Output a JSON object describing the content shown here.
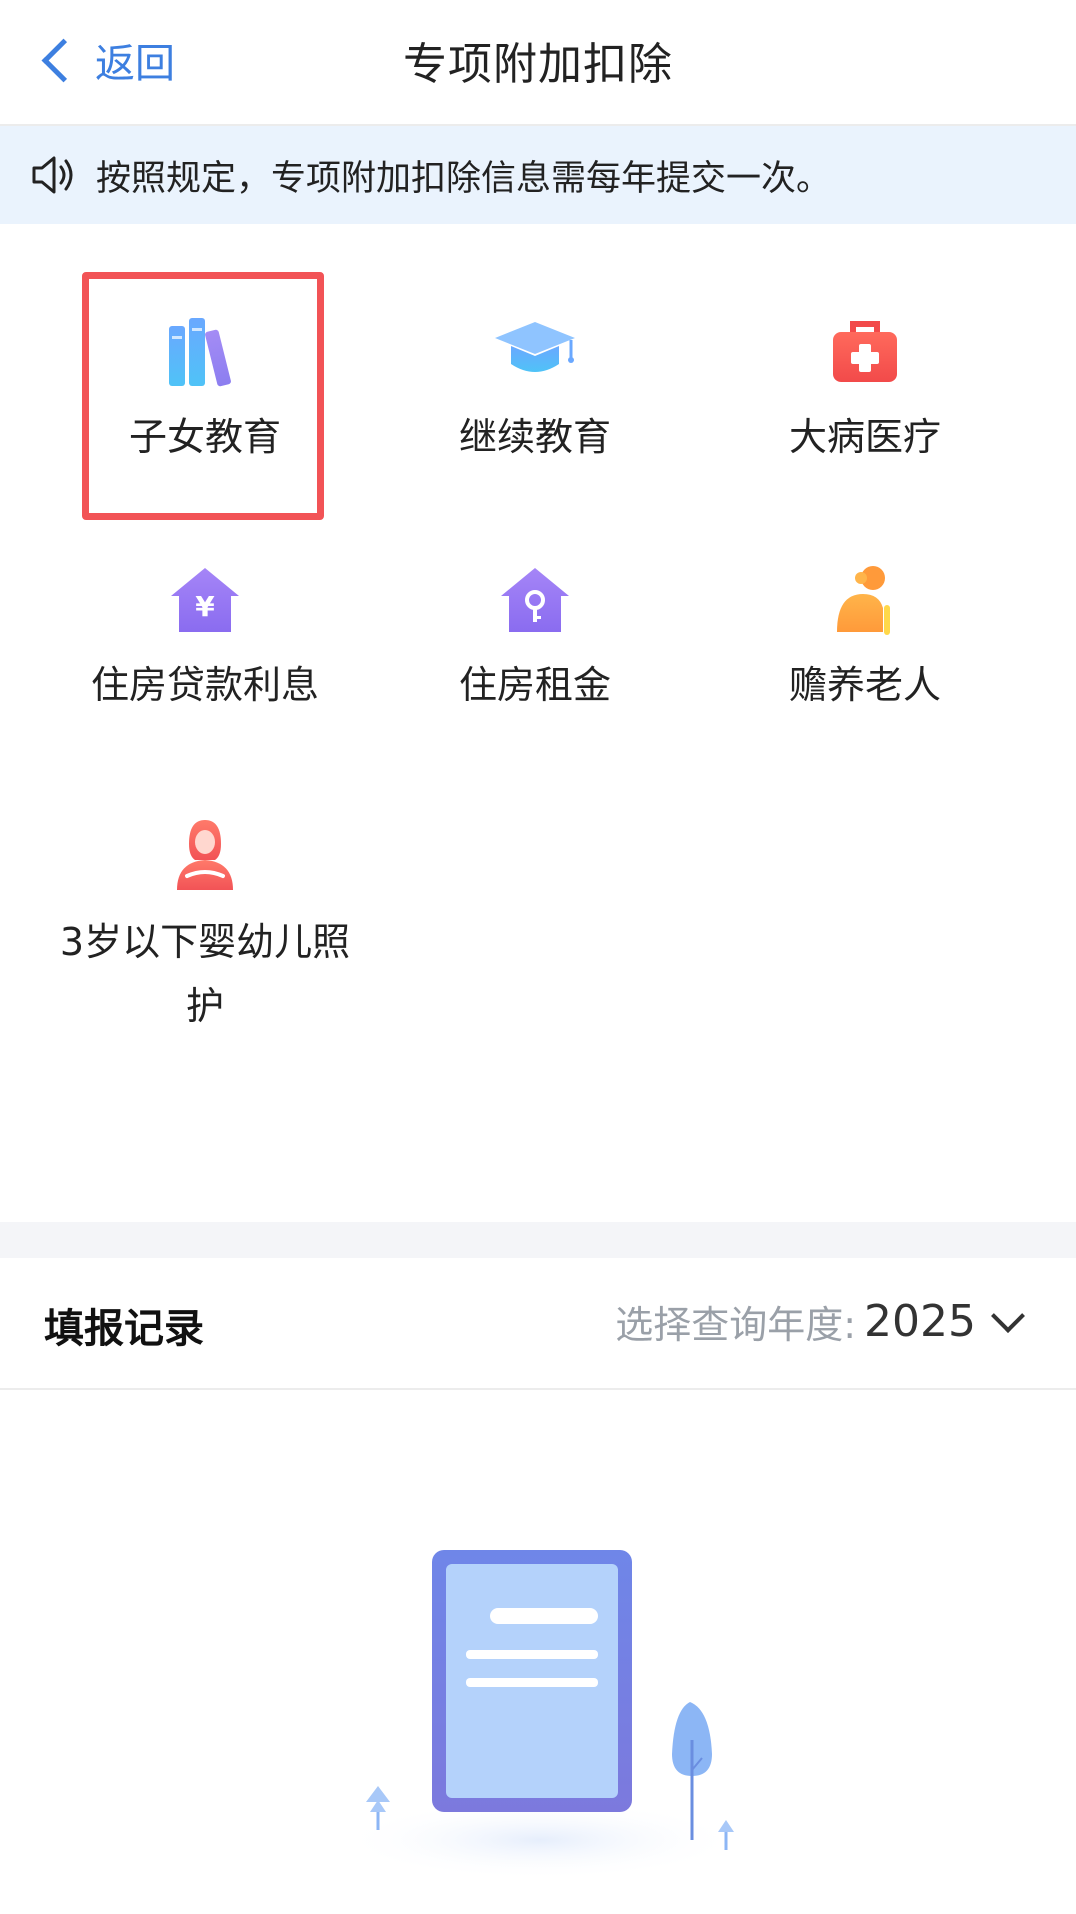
{
  "header": {
    "back_label": "返回",
    "title": "专项附加扣除"
  },
  "notice": {
    "icon": "speaker-icon",
    "text": "按照规定，专项附加扣除信息需每年提交一次。"
  },
  "categories": [
    {
      "label": "子女教育",
      "icon": "books-icon",
      "highlighted": true
    },
    {
      "label": "继续教育",
      "icon": "graduation-cap-icon"
    },
    {
      "label": "大病医疗",
      "icon": "medical-kit-icon"
    },
    {
      "label": "住房贷款利息",
      "icon": "house-yuan-icon"
    },
    {
      "label": "住房租金",
      "icon": "house-key-icon"
    },
    {
      "label": "赡养老人",
      "icon": "elderly-icon"
    },
    {
      "label_line1": "3岁以下婴幼儿照",
      "label_line2": "护",
      "icon": "mother-icon"
    }
  ],
  "records": {
    "title": "填报记录",
    "year_label": "选择查询年度:",
    "year_value": "2025"
  },
  "colors": {
    "accent": "#3d7fe0",
    "highlight": "#f25356",
    "notice_bg": "#eaf3fd"
  }
}
